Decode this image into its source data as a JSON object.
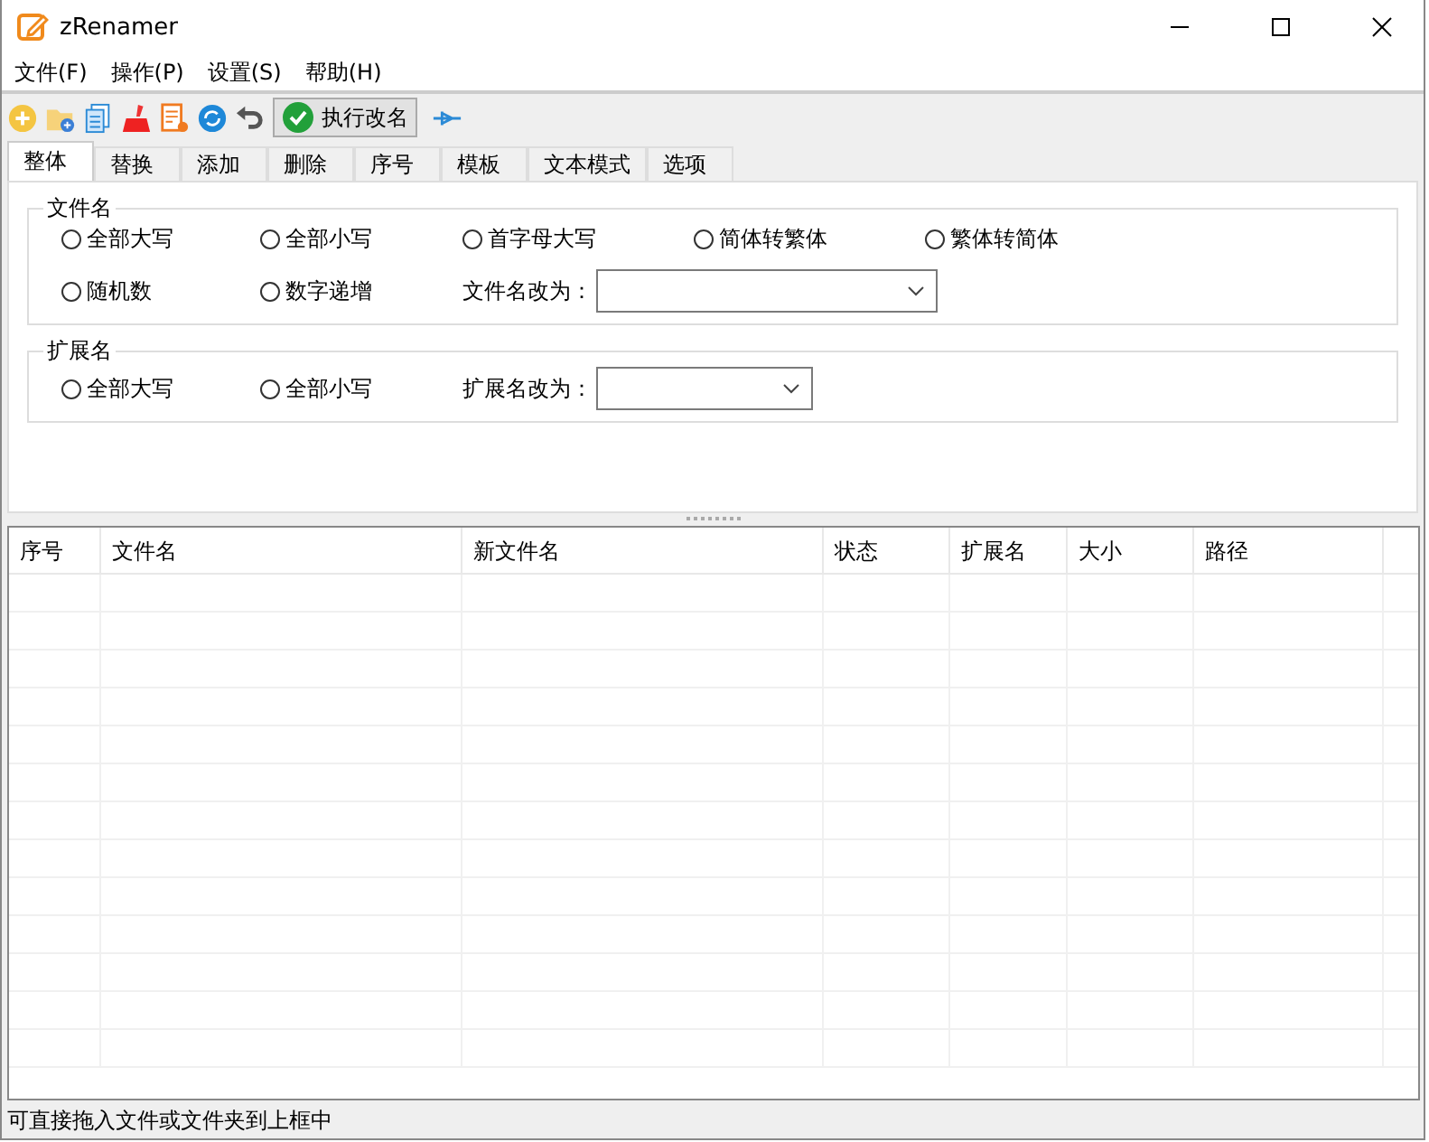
{
  "window": {
    "title": "zRenamer"
  },
  "menu": [
    "文件(F)",
    "操作(P)",
    "设置(S)",
    "帮助(H)"
  ],
  "toolbar": {
    "run_button": "执行改名"
  },
  "tabs": [
    {
      "label": "整体",
      "selected": true
    },
    {
      "label": "替换",
      "selected": false
    },
    {
      "label": "添加",
      "selected": false
    },
    {
      "label": "删除",
      "selected": false
    },
    {
      "label": "序号",
      "selected": false
    },
    {
      "label": "模板",
      "selected": false
    },
    {
      "label": "文本模式",
      "selected": false
    },
    {
      "label": "选项",
      "selected": false
    }
  ],
  "groups": [
    {
      "title": "文件名",
      "items": [
        {
          "kind": "radio",
          "label": "全部大写",
          "selected": false
        },
        {
          "kind": "radio",
          "label": "全部小写",
          "selected": false
        },
        {
          "kind": "radio",
          "label": "首字母大写",
          "selected": false
        },
        {
          "kind": "radio",
          "label": "简体转繁体",
          "selected": false
        },
        {
          "kind": "radio",
          "label": "繁体转简体",
          "selected": false
        },
        {
          "kind": "radio",
          "label": "随机数",
          "selected": false
        },
        {
          "kind": "radio",
          "label": "数字递增",
          "selected": false
        },
        {
          "kind": "dropdown",
          "label": "文件名改为："
        }
      ]
    },
    {
      "title": "扩展名",
      "items": [
        {
          "kind": "radio",
          "label": "全部大写",
          "selected": false
        },
        {
          "kind": "radio",
          "label": "全部小写",
          "selected": false
        },
        {
          "kind": "dropdown",
          "label": "扩展名改为："
        }
      ]
    }
  ],
  "table": {
    "columns": [
      "序号",
      "文件名",
      "新文件名",
      "状态",
      "扩展名",
      "大小",
      "路径"
    ]
  },
  "status_bar": "可直接拖入文件或文件夹到上框中"
}
